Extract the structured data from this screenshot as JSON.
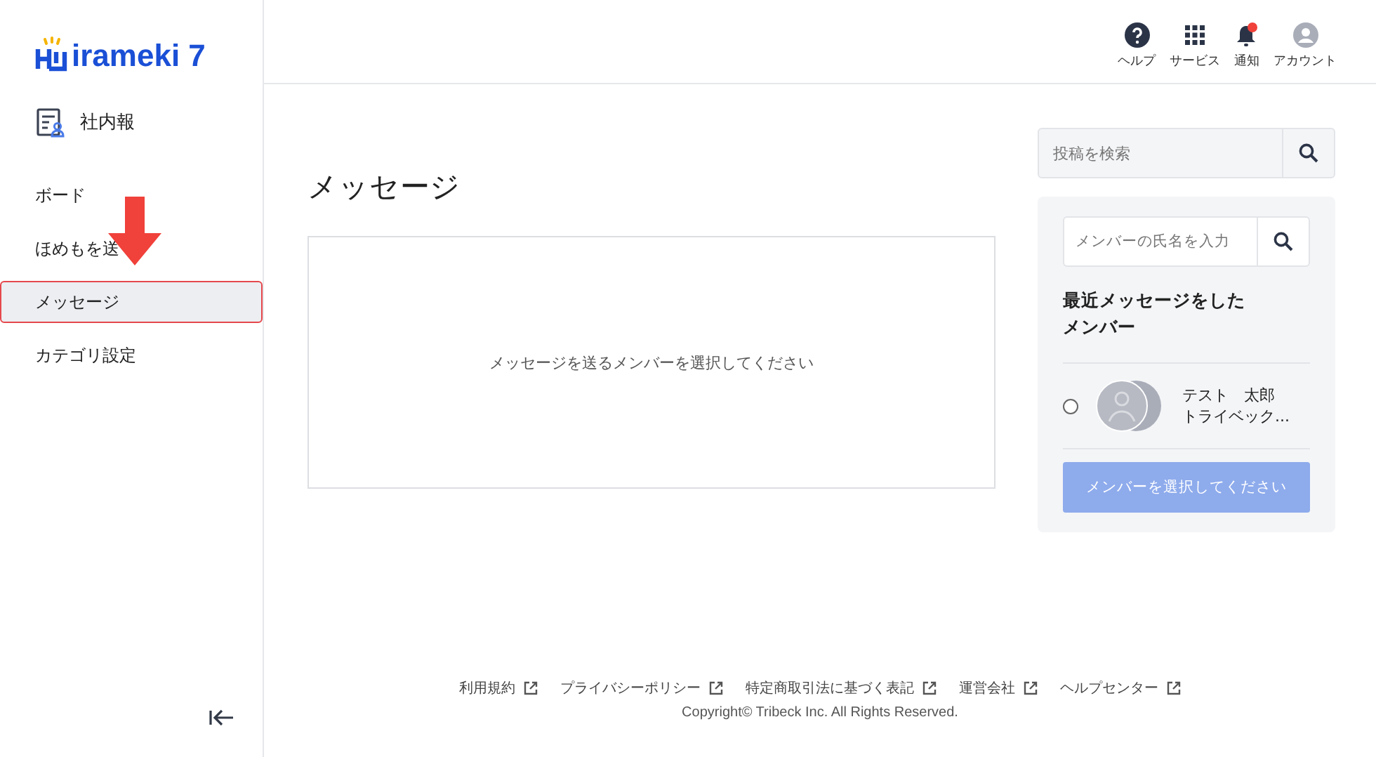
{
  "logo": {
    "text": "irameki 7"
  },
  "sidebar": {
    "section": "社内報",
    "items": [
      {
        "label": "ボード",
        "selected": false
      },
      {
        "label": "ほめもを送",
        "selected": false
      },
      {
        "label": "メッセージ",
        "selected": true
      },
      {
        "label": "カテゴリ設定",
        "selected": false
      }
    ]
  },
  "header": {
    "actions": [
      {
        "kind": "help",
        "label": "ヘルプ"
      },
      {
        "kind": "services",
        "label": "サービス"
      },
      {
        "kind": "notifications",
        "label": "通知",
        "badge": true
      },
      {
        "kind": "account",
        "label": "アカウント"
      }
    ]
  },
  "page": {
    "title": "メッセージ",
    "empty_message": "メッセージを送るメンバーを選択してください"
  },
  "post_search": {
    "placeholder": "投稿を検索"
  },
  "member_panel": {
    "search_placeholder": "メンバーの氏名を入力",
    "heading": "最近メッセージをしたメンバー",
    "members": [
      {
        "name": "テスト　太郎",
        "company": "トライベック...",
        "selected": false
      }
    ],
    "button": {
      "label": "メンバーを選択してください",
      "disabled": true
    }
  },
  "footer": {
    "links": [
      "利用規約",
      "プライバシーポリシー",
      "特定商取引法に基づく表記",
      "運営会社",
      "ヘルプセンター"
    ],
    "copyright": "Copyright© Tribeck Inc. All Rights Reserved."
  }
}
